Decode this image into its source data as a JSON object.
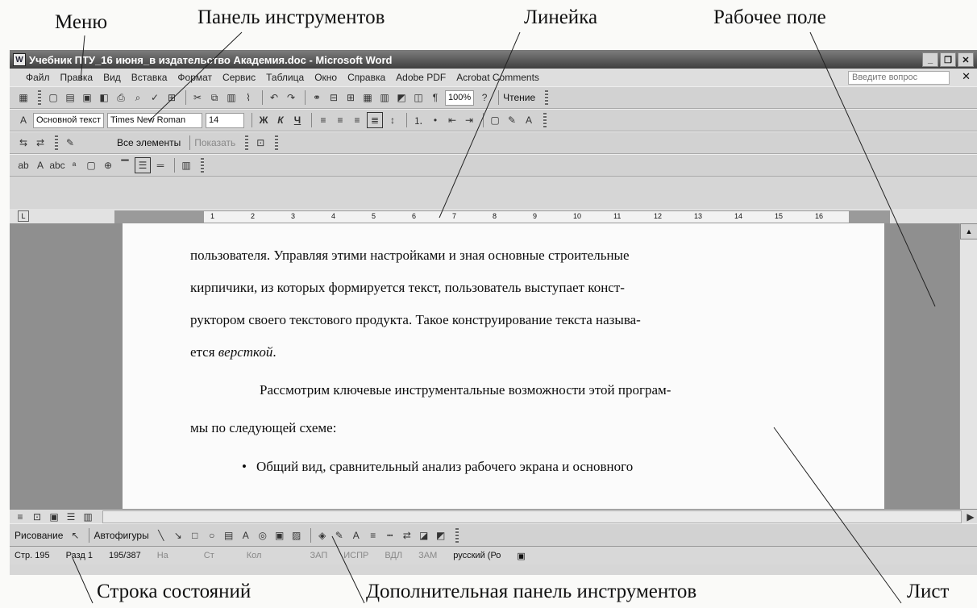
{
  "callouts": {
    "menu": "Меню",
    "toolbar": "Панель инструментов",
    "ruler": "Линейка",
    "workspace": "Рабочее поле",
    "statusbar": "Строка состояний",
    "extra_toolbar": "Дополнительная панель инструментов",
    "sheet": "Лист"
  },
  "window": {
    "title": "Учебник ПТУ_16 июня_в издательство Академия.doc - Microsoft Word",
    "help_placeholder": "Введите вопрос"
  },
  "menu": [
    "Файл",
    "Правка",
    "Вид",
    "Вставка",
    "Формат",
    "Сервис",
    "Таблица",
    "Окно",
    "Справка",
    "Adobe PDF",
    "Acrobat Comments"
  ],
  "toolbar": {
    "zoom": "100%",
    "read_button": "Чтение"
  },
  "formatting": {
    "style": "Основной текст",
    "font": "Times New Roman",
    "size": "14",
    "bold": "Ж",
    "italic": "К",
    "underline": "Ч"
  },
  "review": {
    "elements": "Все элементы",
    "show": "Показать"
  },
  "ruler": {
    "numbers": [
      "1",
      "2",
      "3",
      "4",
      "5",
      "6",
      "7",
      "8",
      "9",
      "10",
      "11",
      "12",
      "13",
      "14",
      "15",
      "16"
    ]
  },
  "document": {
    "lines": [
      "пользователя. Управляя этими настройками и зная основные строительные",
      "кирпичики, из которых  формируется текст, пользователь выступает конст-",
      "руктором своего текстового продукта. Такое конструирование текста называ-",
      "Рассмотрим ключевые инструментальные возможности этой програм-",
      "мы по следующей схеме:",
      "Общий вид, сравнительный анализ рабочего экрана и основного"
    ],
    "line4_prefix": "ется ",
    "line4_italic": "версткой",
    "line4_suffix": "."
  },
  "drawing": {
    "draw_menu": "Рисование",
    "autoshapes": "Автофигуры"
  },
  "status": {
    "page": "Стр. 195",
    "section": "Разд 1",
    "pages": "195/387",
    "at": "На",
    "ln": "Ст",
    "col": "Кол",
    "rec": "ЗАП",
    "trk": "ИСПР",
    "ext": "ВДЛ",
    "ovr": "ЗАМ",
    "language": "русский (Ро"
  }
}
